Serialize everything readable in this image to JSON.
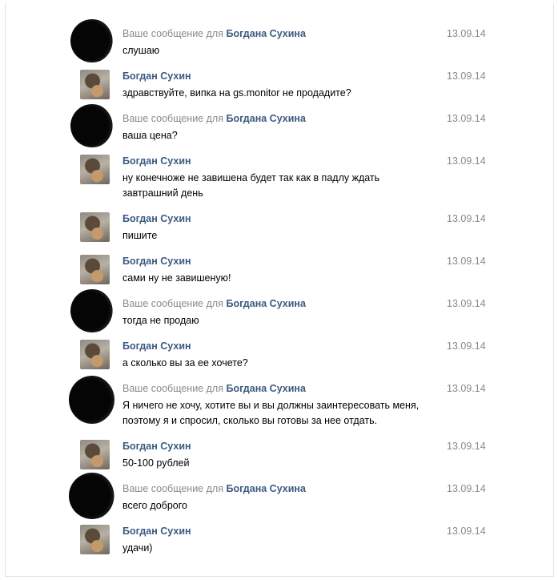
{
  "messages": [
    {
      "type": "outgoing",
      "prefix": "Ваше сообщение для",
      "name": "Богдана Сухина",
      "text": "слушаю",
      "date": "13.09.14"
    },
    {
      "type": "incoming",
      "prefix": "",
      "name": "Богдан Сухин",
      "text": "здравствуйте, випка на gs.monitor не продадите?",
      "date": "13.09.14"
    },
    {
      "type": "outgoing",
      "prefix": "Ваше сообщение для",
      "name": "Богдана Сухина",
      "text": "ваша цена?",
      "date": "13.09.14"
    },
    {
      "type": "incoming",
      "prefix": "",
      "name": "Богдан Сухин",
      "text": "ну конечноже не завишена будет так как в падлу ждать завтрашний день",
      "date": "13.09.14"
    },
    {
      "type": "incoming",
      "prefix": "",
      "name": "Богдан Сухин",
      "text": "пишите",
      "date": "13.09.14"
    },
    {
      "type": "incoming",
      "prefix": "",
      "name": "Богдан Сухин",
      "text": "сами ну не завишеную!",
      "date": "13.09.14"
    },
    {
      "type": "outgoing",
      "prefix": "Ваше сообщение для",
      "name": "Богдана Сухина",
      "text": "тогда не продаю",
      "date": "13.09.14"
    },
    {
      "type": "incoming",
      "prefix": "",
      "name": "Богдан Сухин",
      "text": "а сколько вы за ее хочете?",
      "date": "13.09.14"
    },
    {
      "type": "outgoing",
      "prefix": "Ваше сообщение для",
      "name": "Богдана Сухина",
      "text": "Я ничего не хочу, хотите вы и вы должны заинтересовать меня, поэтому я и спросил, сколько вы готовы за нее отдать.",
      "date": "13.09.14"
    },
    {
      "type": "incoming",
      "prefix": "",
      "name": "Богдан Сухин",
      "text": "50-100 рублей",
      "date": "13.09.14"
    },
    {
      "type": "outgoing",
      "prefix": "Ваше сообщение для",
      "name": "Богдана Сухина",
      "text": "всего доброго",
      "date": "13.09.14"
    },
    {
      "type": "incoming",
      "prefix": "",
      "name": "Богдан Сухин",
      "text": "удачи)",
      "date": "13.09.14"
    }
  ]
}
